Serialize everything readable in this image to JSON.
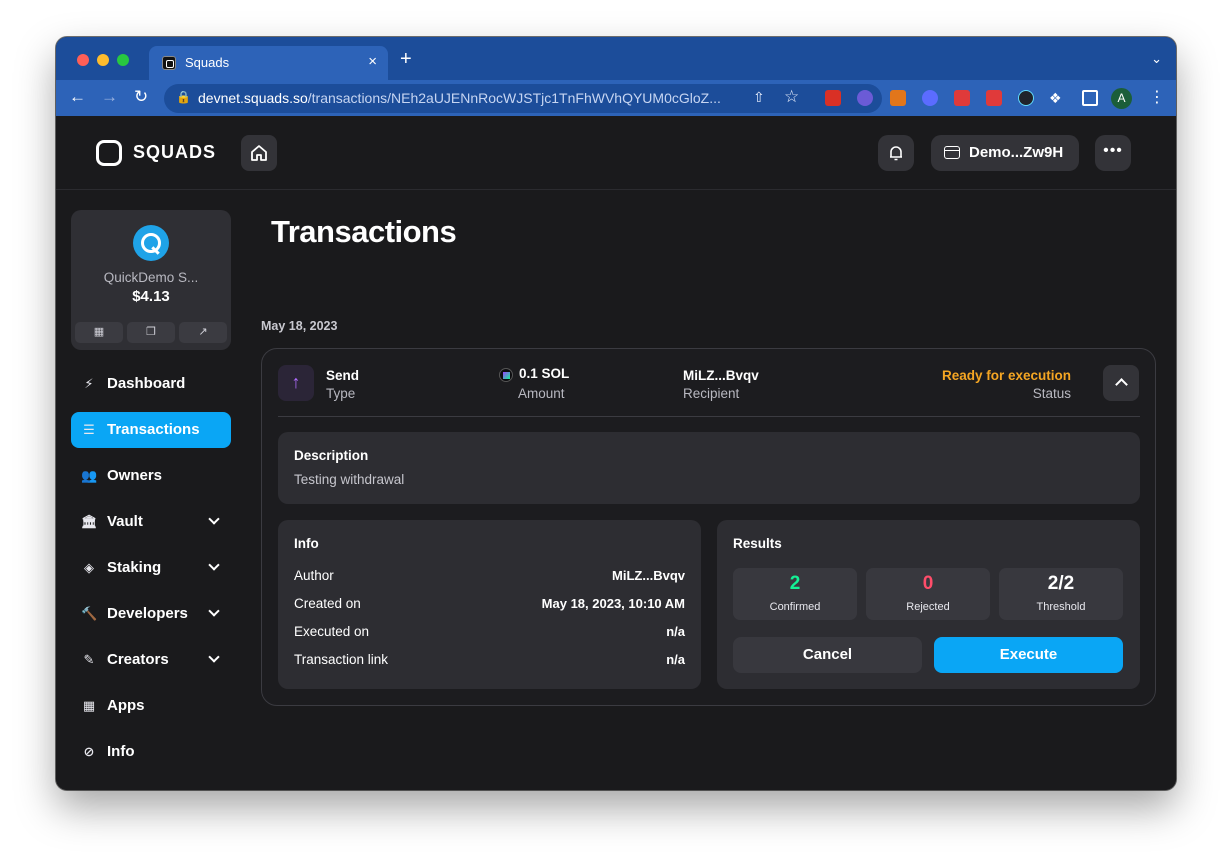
{
  "browser": {
    "tab_title": "Squads",
    "tab_close": "×",
    "new_tab": "+",
    "url_host": "devnet.squads.so",
    "url_path": "/transactions/NEh2aUJENnRocWJSTjc1TnFhWVhQYUM0cGloZ...",
    "profile_initial": "A",
    "extensions": [
      "red-ext-icon",
      "ghost-ext-icon",
      "fox-ext-icon",
      "snowflake-ext-icon",
      "lock-red-ext-icon",
      "lock-red-ext-icon-2",
      "react-ext-icon"
    ]
  },
  "header": {
    "logo": "SQUADS",
    "wallet_label": "Demo...Zw9H",
    "more": "•••"
  },
  "squad": {
    "name": "QuickDemo S...",
    "balance": "$4.13"
  },
  "sidebar": {
    "items": [
      {
        "label": "Dashboard",
        "icon": "⚡"
      },
      {
        "label": "Transactions",
        "icon": "☰"
      },
      {
        "label": "Owners",
        "icon": "👥"
      },
      {
        "label": "Vault",
        "icon": "🏛"
      },
      {
        "label": "Staking",
        "icon": "◈"
      },
      {
        "label": "Developers",
        "icon": "🔨"
      },
      {
        "label": "Creators",
        "icon": "✎"
      },
      {
        "label": "Apps",
        "icon": "▦"
      },
      {
        "label": "Info",
        "icon": "⊘"
      }
    ]
  },
  "main": {
    "title": "Transactions",
    "date": "May 18, 2023",
    "transaction": {
      "type_value": "Send",
      "type_label": "Type",
      "amount_value": "0.1 SOL",
      "amount_label": "Amount",
      "recipient_value": "MiLZ...Bvqv",
      "recipient_label": "Recipient",
      "status_value": "Ready for execution",
      "status_label": "Status",
      "description_title": "Description",
      "description_text": "Testing withdrawal",
      "info_title": "Info",
      "info_rows": [
        {
          "key": "Author",
          "value": "MiLZ...Bvqv"
        },
        {
          "key": "Created on",
          "value": "May 18, 2023, 10:10 AM"
        },
        {
          "key": "Executed on",
          "value": "n/a"
        },
        {
          "key": "Transaction link",
          "value": "n/a"
        }
      ],
      "results_title": "Results",
      "results": [
        {
          "value": "2",
          "label": "Confirmed"
        },
        {
          "value": "0",
          "label": "Rejected"
        },
        {
          "value": "2/2",
          "label": "Threshold"
        }
      ],
      "cancel_label": "Cancel",
      "execute_label": "Execute"
    }
  },
  "colors": {
    "accent": "#0aa6f5",
    "status_ready": "#f5a623",
    "confirmed": "#14f195",
    "rejected": "#ff4d6a"
  }
}
